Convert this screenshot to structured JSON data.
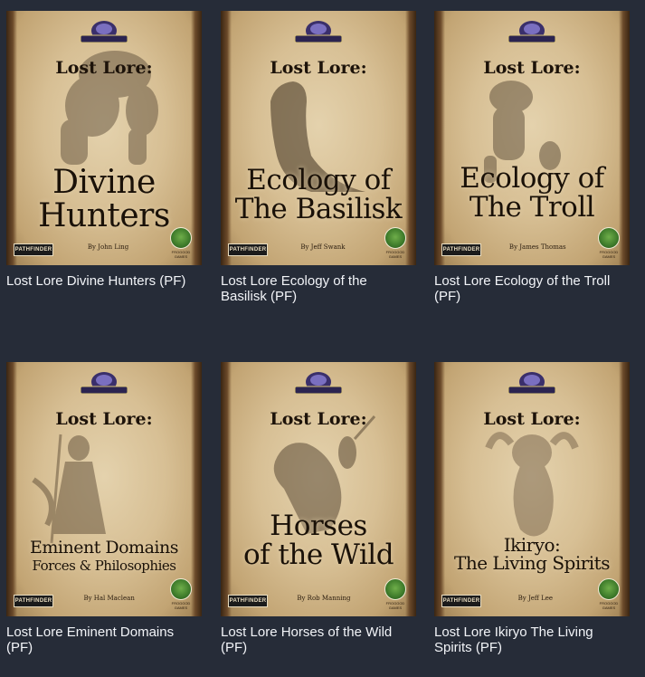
{
  "products": [
    {
      "title": "Lost Lore Divine Hunters (PF)",
      "cover": {
        "series": "Lost Lore:",
        "line1": "Divine",
        "line2": "Hunters",
        "subtitle": "",
        "author": "By John Ling",
        "pathfinder": "PATHFINDER",
        "publisher": "FROGGOD GAMES",
        "art_icon": "ogre-hunter-illustration"
      }
    },
    {
      "title": "Lost Lore Ecology of the Basilisk (PF)",
      "cover": {
        "series": "Lost Lore:",
        "line1": "Ecology of",
        "line2": "The Basilisk",
        "subtitle": "",
        "author": "By Jeff Swank",
        "pathfinder": "PATHFINDER",
        "publisher": "FROGGOD GAMES",
        "art_icon": "basilisk-illustration"
      }
    },
    {
      "title": "Lost Lore Ecology of the Troll (PF)",
      "cover": {
        "series": "Lost Lore:",
        "line1": "Ecology of",
        "line2": "The Troll",
        "subtitle": "",
        "author": "By James Thomas",
        "pathfinder": "PATHFINDER",
        "publisher": "FROGGOD GAMES",
        "art_icon": "troll-illustration"
      }
    },
    {
      "title": "Lost Lore Eminent Domains (PF)",
      "cover": {
        "series": "Lost Lore:",
        "line1": "Eminent Domains",
        "line2": "",
        "subtitle": "Forces & Philosophies",
        "author": "By Hal Maclean",
        "pathfinder": "PATHFINDER",
        "publisher": "FROGGOD GAMES",
        "art_icon": "sorcerer-illustration"
      }
    },
    {
      "title": "Lost Lore Horses of the Wild (PF)",
      "cover": {
        "series": "Lost Lore:",
        "line1": "Horses",
        "line2": "of the Wild",
        "subtitle": "",
        "author": "By Rob Manning",
        "pathfinder": "PATHFINDER",
        "publisher": "FROGGOD GAMES",
        "art_icon": "rearing-horse-illustration"
      }
    },
    {
      "title": "Lost Lore Ikiryo The Living Spirits (PF)",
      "cover": {
        "series": "Lost Lore:",
        "line1": "Ikiryo:",
        "line2": "The Living Spirits",
        "subtitle": "",
        "author": "By Jeff Lee",
        "pathfinder": "PATHFINDER",
        "publisher": "FROGGOD GAMES",
        "art_icon": "spirit-illustration"
      }
    }
  ],
  "colors": {
    "background": "#262c38",
    "title_text": "#f2f4f8",
    "parchment": "#d7bf94"
  },
  "publisher_logo": "lost-lands-logo-icon"
}
